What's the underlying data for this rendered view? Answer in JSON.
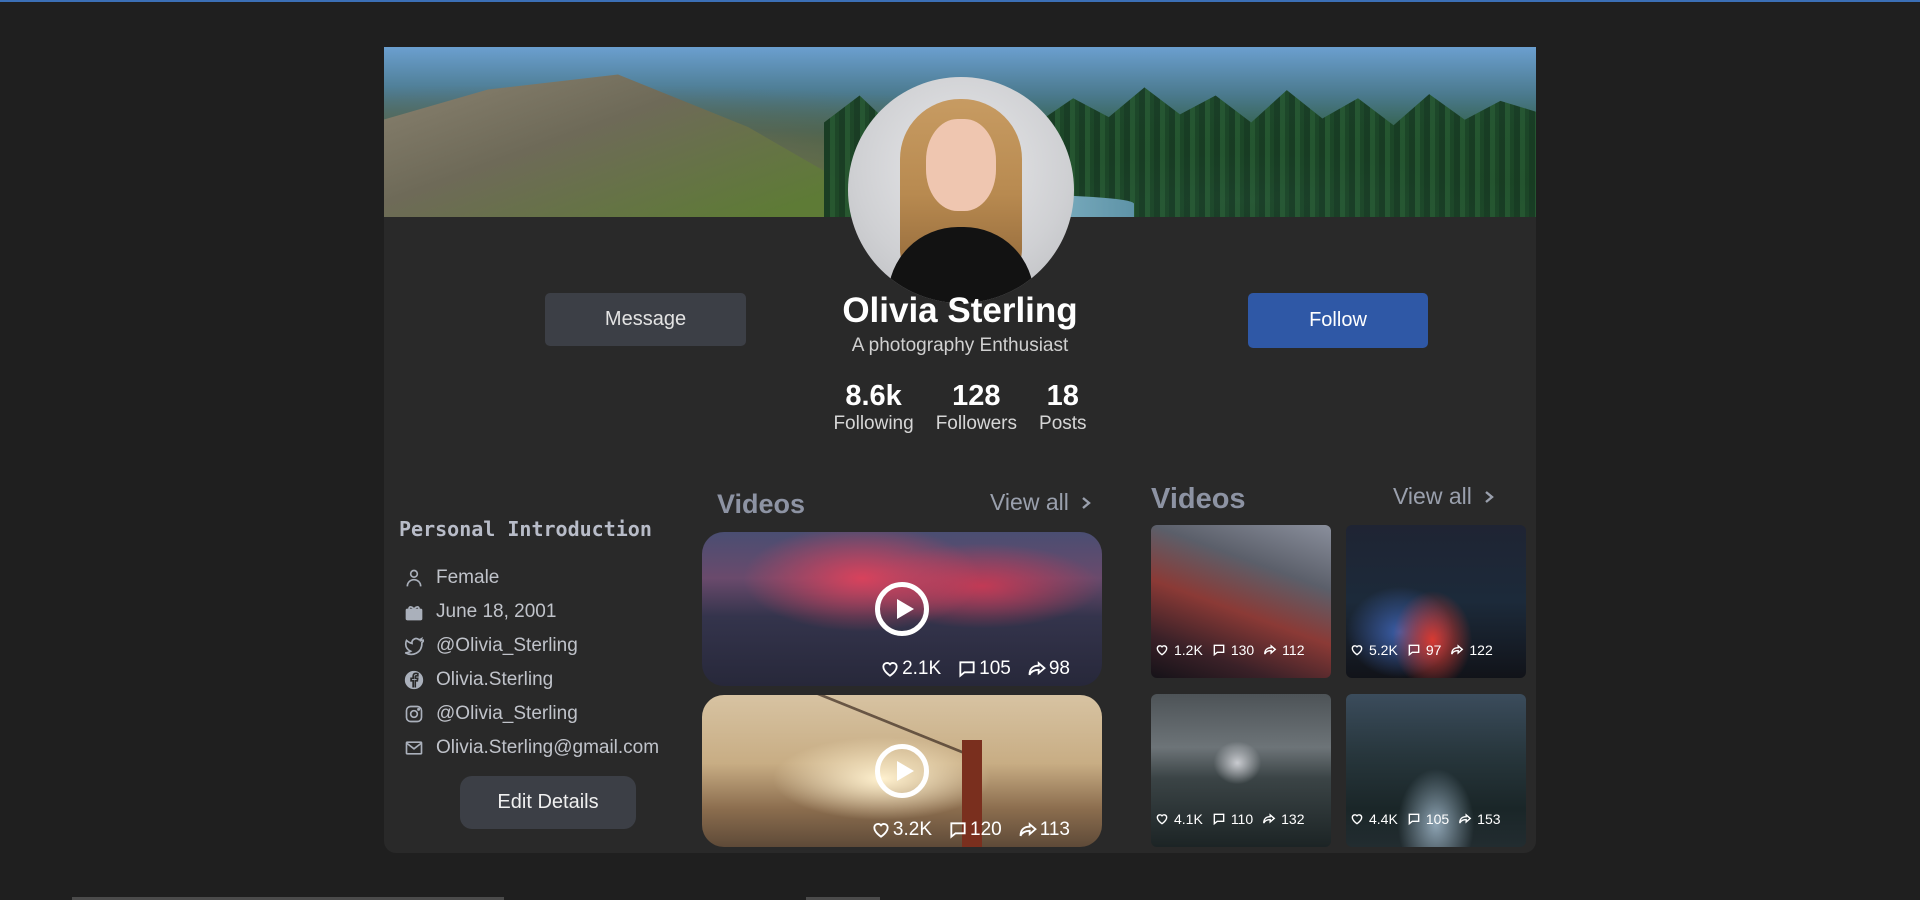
{
  "profile": {
    "name": "Olivia Sterling",
    "tagline": "A photography Enthusiast",
    "message_label": "Message",
    "follow_label": "Follow",
    "stats": [
      {
        "value": "8.6k",
        "label": "Following"
      },
      {
        "value": "128",
        "label": "Followers"
      },
      {
        "value": "18",
        "label": "Posts"
      }
    ]
  },
  "intro": {
    "title": "Personal Introduction",
    "items": [
      {
        "icon": "person-icon",
        "text": "Female"
      },
      {
        "icon": "gift-icon",
        "text": "June 18, 2001"
      },
      {
        "icon": "twitter-icon",
        "text": "@Olivia_Sterling"
      },
      {
        "icon": "facebook-icon",
        "text": "Olivia.Sterling"
      },
      {
        "icon": "instagram-icon",
        "text": "@Olivia_Sterling"
      },
      {
        "icon": "mail-icon",
        "text": "Olivia.Sterling@gmail.com"
      }
    ],
    "edit_label": "Edit Details"
  },
  "videos_left": {
    "title": "Videos",
    "view_all": "View all",
    "items": [
      {
        "likes": "2.1K",
        "comments": "105",
        "shares": "98"
      },
      {
        "likes": "3.2K",
        "comments": "120",
        "shares": "113"
      }
    ]
  },
  "videos_right": {
    "title": "Videos",
    "view_all": "View all",
    "items": [
      {
        "likes": "1.2K",
        "comments": "130",
        "shares": "112"
      },
      {
        "likes": "5.2K",
        "comments": "97",
        "shares": "122"
      },
      {
        "likes": "4.1K",
        "comments": "110",
        "shares": "132"
      },
      {
        "likes": "4.4K",
        "comments": "105",
        "shares": "153"
      }
    ]
  },
  "colors": {
    "accent": "#2f58a6",
    "card_bg": "#292929",
    "page_bg": "#1f1f1f"
  }
}
